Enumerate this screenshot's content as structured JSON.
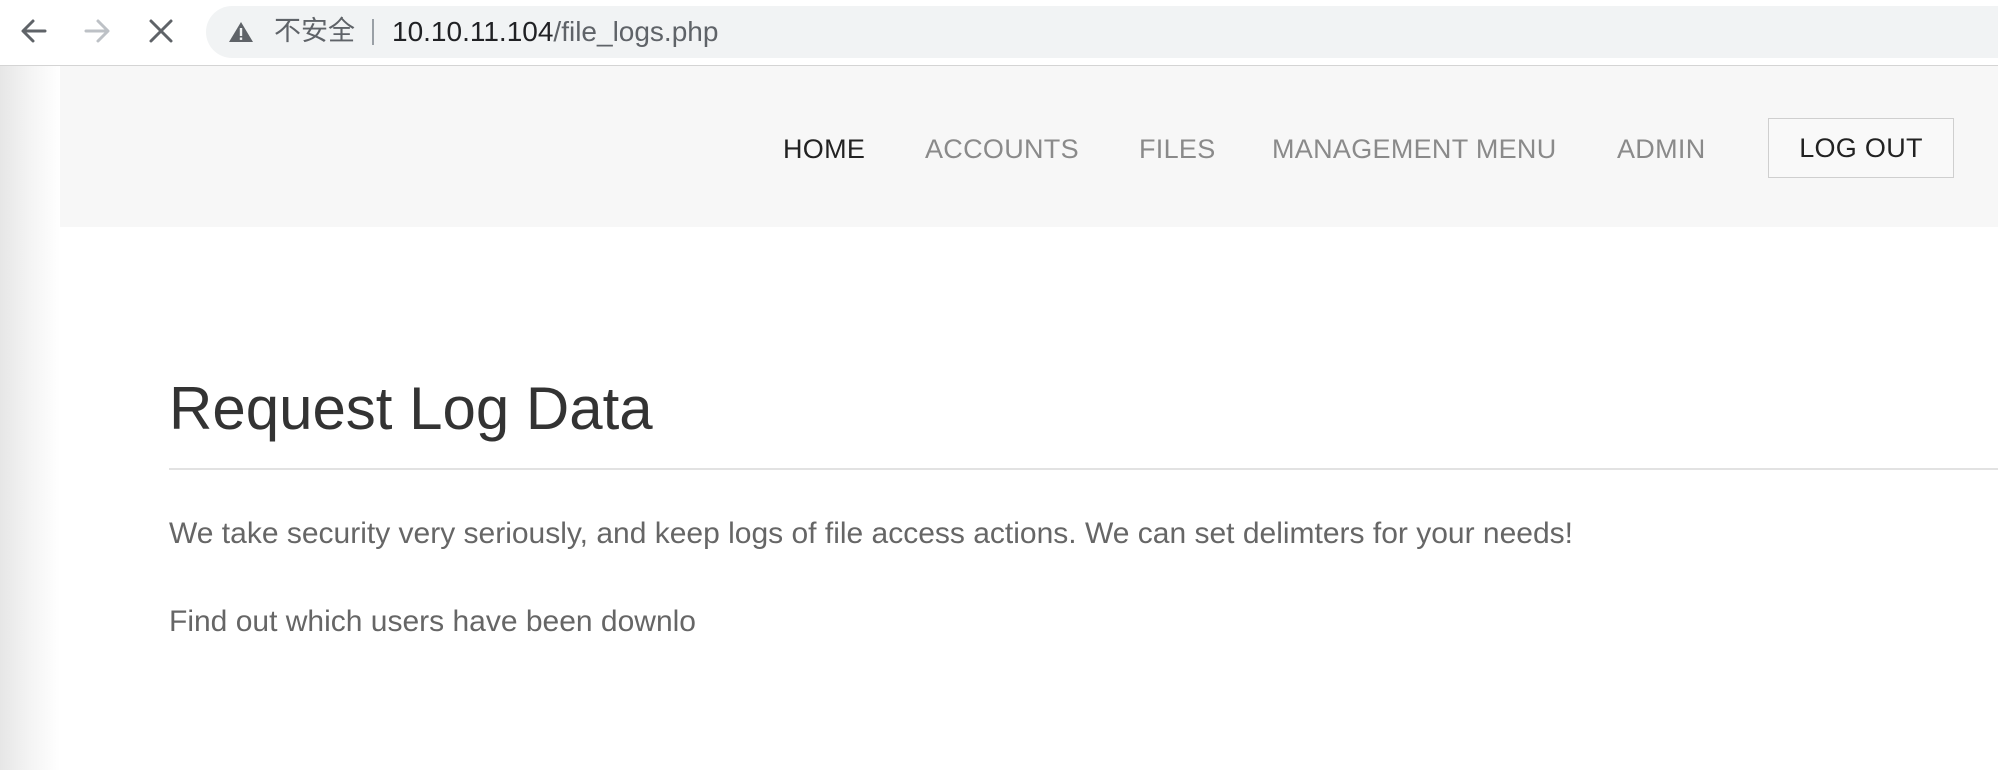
{
  "browser": {
    "security_label": "不安全",
    "url_host": "10.10.11.104",
    "url_path": "/file_logs.php"
  },
  "nav": {
    "items": [
      {
        "label": "HOME",
        "active": true
      },
      {
        "label": "ACCOUNTS",
        "active": false
      },
      {
        "label": "FILES",
        "active": false
      },
      {
        "label": "MANAGEMENT MENU",
        "active": false
      },
      {
        "label": "ADMIN",
        "active": false
      }
    ],
    "logout_label": "LOG OUT"
  },
  "main": {
    "title": "Request Log Data",
    "paragraphs": [
      "We take security very seriously, and keep logs of file access actions. We can set delimters for your needs!",
      "Find out which users have been downlo"
    ]
  },
  "icons": {
    "back": "arrow-left-icon",
    "forward": "arrow-right-icon",
    "stop": "close-icon",
    "warning": "warning-triangle-icon"
  },
  "colors": {
    "header_bg": "#f7f7f7",
    "nav_active": "#222222",
    "nav_inactive": "#8a8a8a",
    "body_text": "#666666",
    "title_text": "#333333"
  }
}
